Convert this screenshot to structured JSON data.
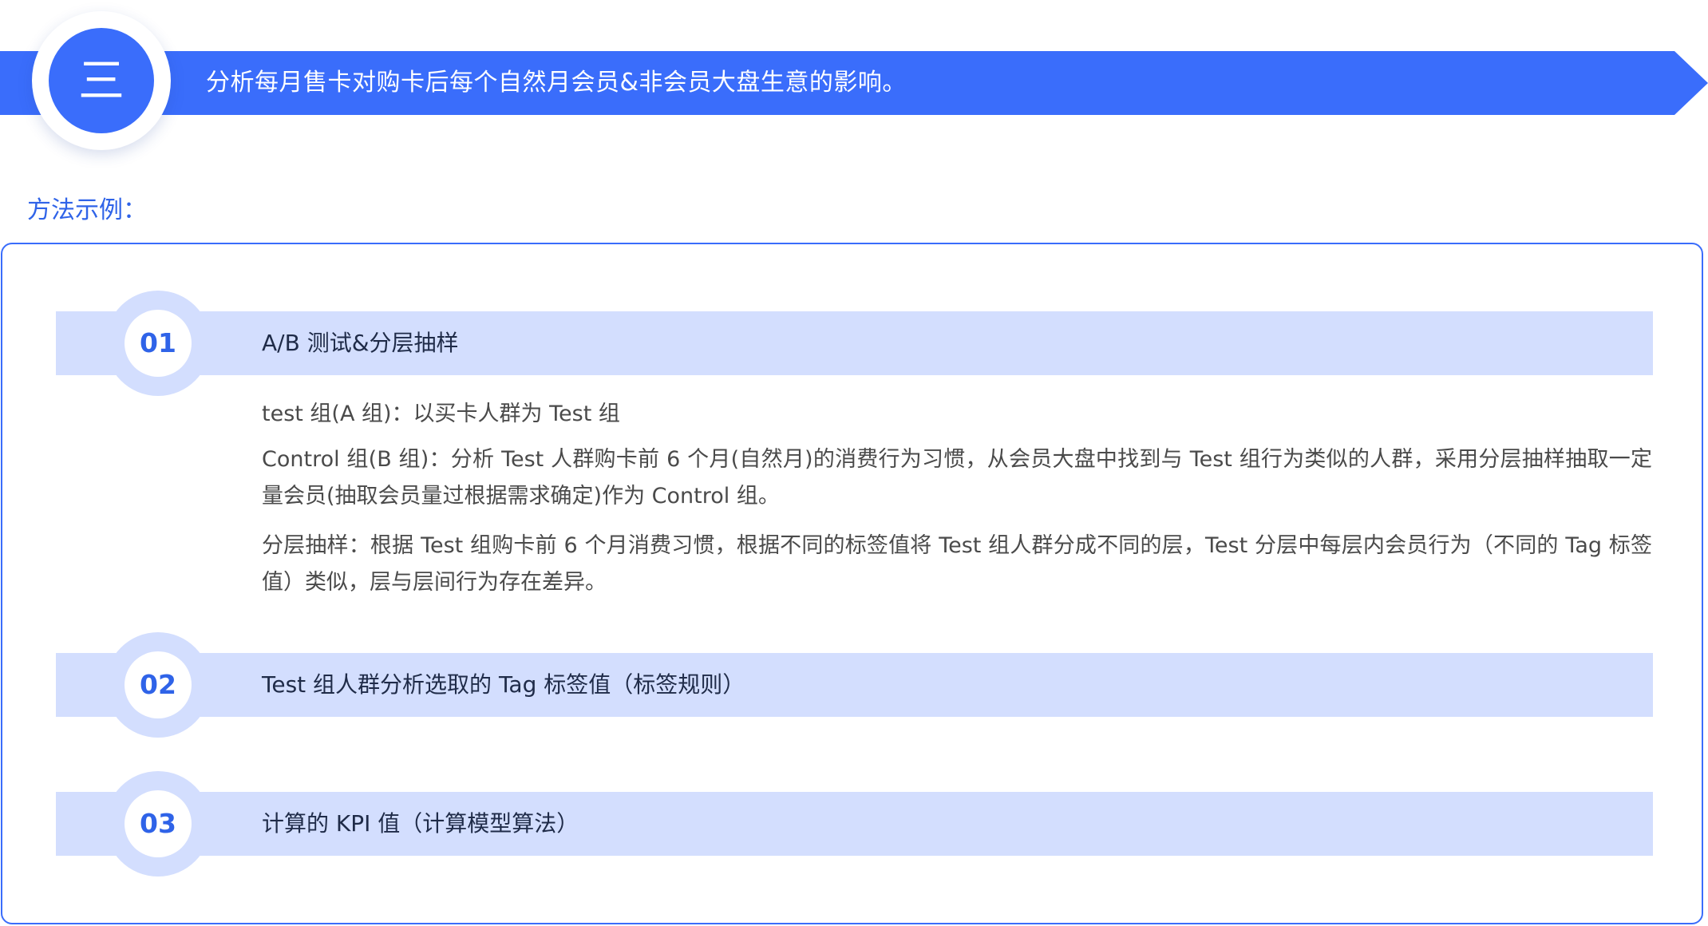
{
  "header": {
    "numeral": "三",
    "title": "分析每月售卡对购卡后每个自然月会员&非会员大盘生意的影响。"
  },
  "method_label": "方法示例：",
  "steps": [
    {
      "number": "01",
      "title": "A/B 测试&分层抽样",
      "paragraphs": [
        "test 组(A 组)：以买卡人群为 Test 组",
        "Control 组(B 组)：分析 Test 人群购卡前 6 个月(自然月)的消费行为习惯，从会员大盘中找到与 Test 组行为类似的人群，采用分层抽样抽取一定量会员(抽取会员量过根据需求确定)作为 Control 组。",
        "分层抽样：根据 Test 组购卡前 6 个月消费习惯，根据不同的标签值将 Test 组人群分成不同的层，Test 分层中每层内会员行为（不同的 Tag 标签值）类似，层与层间行为存在差异。"
      ]
    },
    {
      "number": "02",
      "title": "Test 组人群分析选取的 Tag 标签值（标签规则）"
    },
    {
      "number": "03",
      "title": "计算的 KPI 值（计算模型算法）"
    }
  ],
  "colors": {
    "primary": "#3a6dfb",
    "light_band": "#d3defe",
    "accent_text": "#2f63e8"
  }
}
